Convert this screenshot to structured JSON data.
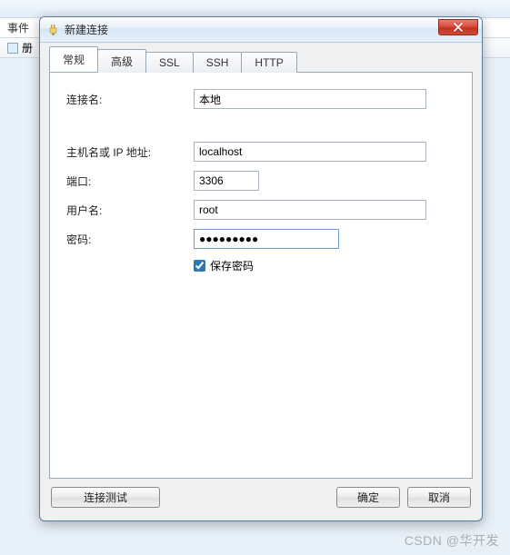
{
  "background": {
    "events_label": "事件",
    "side_label": "册"
  },
  "dialog": {
    "title": "新建连接",
    "tabs": [
      {
        "label": "常规",
        "active": true
      },
      {
        "label": "高级",
        "active": false
      },
      {
        "label": "SSL",
        "active": false
      },
      {
        "label": "SSH",
        "active": false
      },
      {
        "label": "HTTP",
        "active": false
      }
    ],
    "fields": {
      "conn_name_label": "连接名:",
      "conn_name_value": "本地",
      "host_label": "主机名或 IP 地址:",
      "host_value": "localhost",
      "port_label": "端口:",
      "port_value": "3306",
      "user_label": "用户名:",
      "user_value": "root",
      "pass_label": "密码:",
      "pass_value": "●●●●●●●●●",
      "save_pass_label": "保存密码",
      "save_pass_checked": true
    },
    "buttons": {
      "test": "连接测试",
      "ok": "确定",
      "cancel": "取消"
    }
  },
  "watermark": "CSDN @华开发"
}
